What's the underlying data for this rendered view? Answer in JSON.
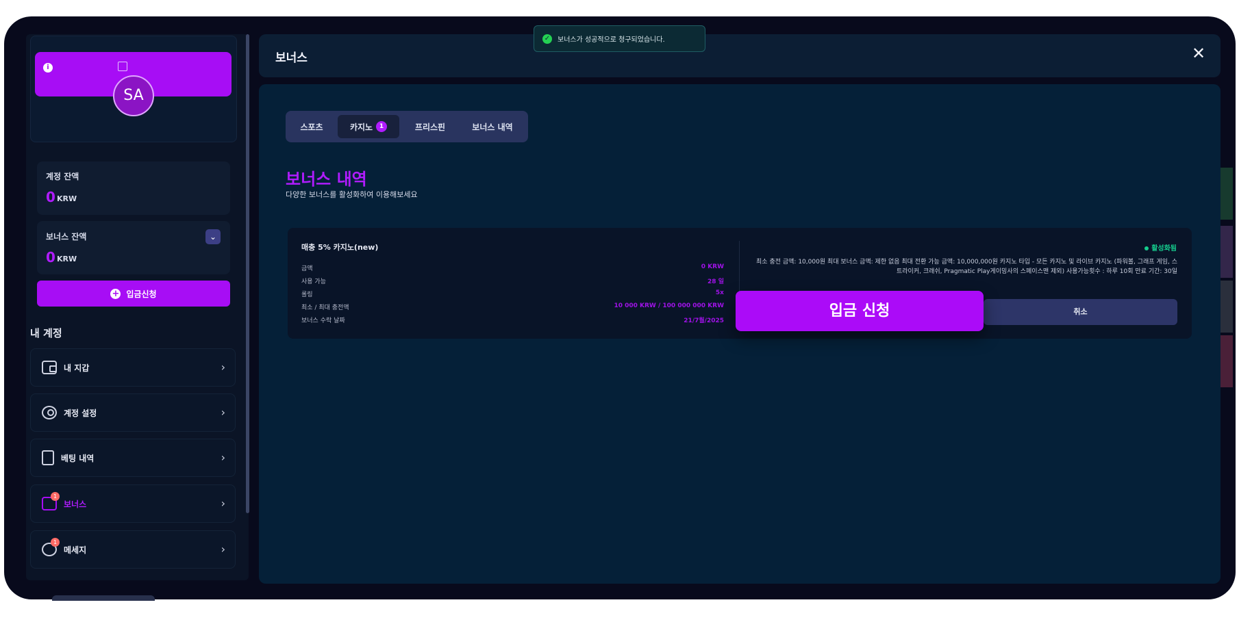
{
  "toast": {
    "message": "보너스가 성공적으로 청구되었습니다."
  },
  "sidebar": {
    "avatar_initials": "SA",
    "account_balance": {
      "label": "계정 잔액",
      "value": "0",
      "unit": "KRW"
    },
    "bonus_balance": {
      "label": "보너스 잔액",
      "value": "0",
      "unit": "KRW"
    },
    "deposit_button_label": "입금신청",
    "section_title": "내 계정",
    "menu": [
      {
        "label": "내 지갑",
        "icon": "wallet-icon"
      },
      {
        "label": "계정 설정",
        "icon": "user-icon"
      },
      {
        "label": "베팅 내역",
        "icon": "receipt-icon"
      },
      {
        "label": "보너스",
        "icon": "gift-icon",
        "badge": "1"
      },
      {
        "label": "메세지",
        "icon": "chat-icon",
        "badge": "1"
      }
    ]
  },
  "modal": {
    "title": "보너스",
    "tabs": [
      {
        "label": "스포츠"
      },
      {
        "label": "카지노",
        "badge": "1"
      },
      {
        "label": "프리스핀"
      },
      {
        "label": "보너스 내역"
      }
    ],
    "heading": "보너스 내역",
    "subheading": "다양한 보너스를 활성화하여 이용해보세요",
    "bonus": {
      "name": "매충 5% 카지노(new)",
      "details": [
        {
          "label": "금액",
          "value": "0 KRW"
        },
        {
          "label": "사용 가능",
          "value": "28 일"
        },
        {
          "label": "롤링",
          "value": "5x"
        },
        {
          "label": "최소 / 최대 충전액",
          "value": "10 000 KRW / 100 000 000 KRW"
        },
        {
          "label": "보너스 수락 날짜",
          "value": "21/7월/2025"
        }
      ],
      "status": "활성화됨",
      "description": "최소 충전 금액: 10,000원 최대 보너스 금액: 제한 없음 최대 전환 가능 금액: 10,000,000원 카지노 타입 - 모든 카지노 및 라이브 카지노 (파워볼, 그래프 게임, 스트라이커, 크래쉬, Pragmatic Play게이밍사의 스페이스맨 제외) 사용가능횟수 : 하루 10회 만료 기간: 30일",
      "cancel_label": "취소"
    },
    "deposit_apply_label": "입금 신청"
  },
  "colors": {
    "accent": "#ab0bf8",
    "success": "#15cc8d",
    "background": "#080a1c"
  }
}
